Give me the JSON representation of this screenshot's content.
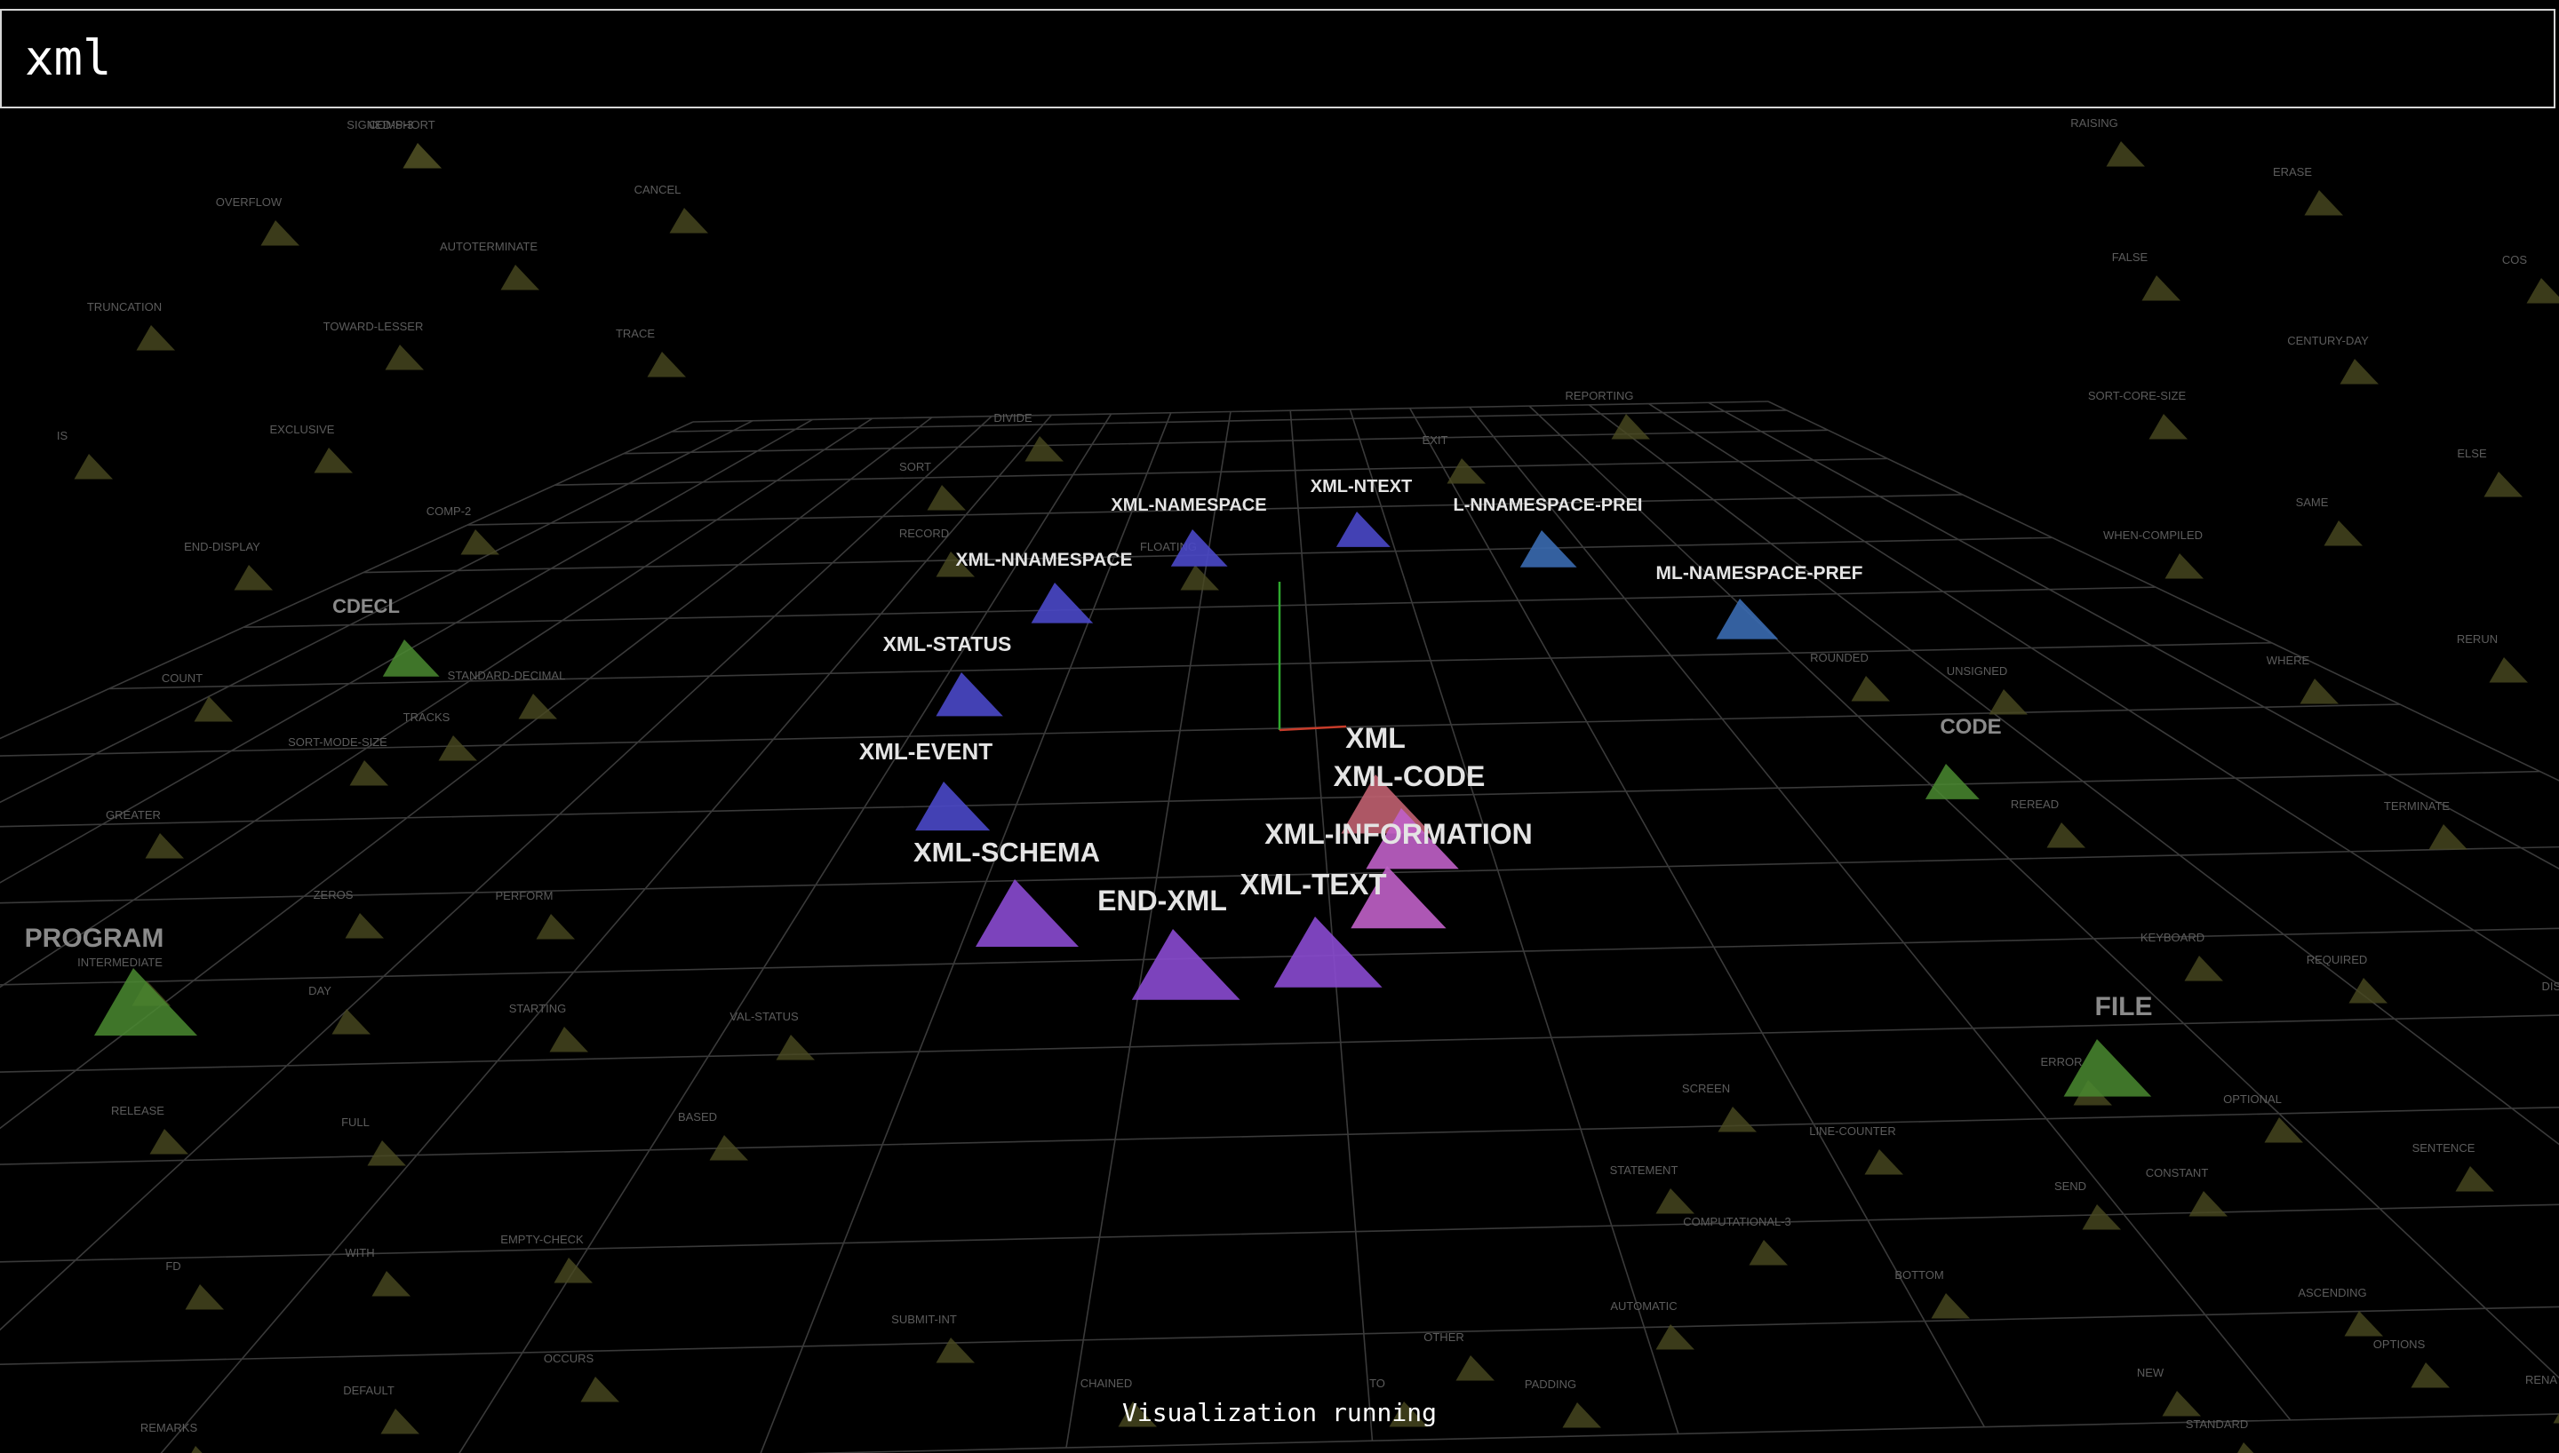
{
  "search": {
    "value": "xml"
  },
  "status": {
    "text": "Visualization running"
  },
  "colors": {
    "background": "#000000",
    "grid": "#3a3a3a",
    "match_blue": "#4a48c8",
    "match_purple": "#8a4ad0",
    "match_pink": "#c060c8",
    "match_red": "#c06070",
    "near_green": "#4a8a30",
    "dim_olive": "#4a4a20",
    "axis_green": "#2ea82e",
    "axis_red": "#c83c2a"
  },
  "highlighted_nodes": [
    {
      "label": "XML-NAMESPACE",
      "color": "blue"
    },
    {
      "label": "XML-NTEXT",
      "color": "blue"
    },
    {
      "label": "L-NNAMESPACE-PREI",
      "color": "steel"
    },
    {
      "label": "XML-NNAMESPACE",
      "color": "blue"
    },
    {
      "label": "ML-NAMESPACE-PREF",
      "color": "steel"
    },
    {
      "label": "XML-STATUS",
      "color": "blue"
    },
    {
      "label": "XML-EVENT",
      "color": "blue"
    },
    {
      "label": "XML",
      "color": "red"
    },
    {
      "label": "XML-CODE",
      "color": "pink"
    },
    {
      "label": "XML-INFORMATION",
      "color": "pink"
    },
    {
      "label": "XML-SCHEMA",
      "color": "purple"
    },
    {
      "label": "END-XML",
      "color": "purple"
    },
    {
      "label": "XML-TEXT",
      "color": "purple"
    }
  ],
  "near_nodes": [
    {
      "label": "CDECL"
    },
    {
      "label": "CODE"
    },
    {
      "label": "PROGRAM"
    },
    {
      "label": "FILE"
    }
  ],
  "background_nodes": [
    "COMP-3",
    "OVERFLOW",
    "TRUNCATION",
    "TOWARD-LESSER",
    "AUTOTERMINATE",
    "CANCEL",
    "EXCLUSIVE",
    "IS",
    "END-DISPLAY",
    "COMP-2",
    "COUNT",
    "SORT-MODE-SIZE",
    "GREATER",
    "ZEROS",
    "INTERMEDIATE",
    "DAY",
    "RELEASE",
    "FULL",
    "WITH",
    "FD",
    "REMARKS",
    "DEFAULT",
    "OCCURS",
    "EMPTY-CHECK",
    "RAISING",
    "ERASE",
    "FALSE",
    "COS",
    "CENTURY-DAY",
    "SORT-CORE-SIZE",
    "ELSE",
    "SAME",
    "WHEN-COMPILED",
    "WHERE",
    "RERUN",
    "UNSIGNED",
    "REREAD",
    "TERMINATE",
    "KEYBOARD",
    "REQUIRED",
    "DISAB",
    "OPTIONAL",
    "SENTENCE",
    "CONSTANT",
    "ASCENDING",
    "OPTIONS",
    "STANDARD",
    "RENA",
    "STANDARD-DECIMAL",
    "TRACKS",
    "PERFORM",
    "STARTING",
    "BASED",
    "VAL-STATUS",
    "ROUNDED",
    "ERROR",
    "SCREEN",
    "LINE-COUNTER",
    "TRACE",
    "BOTTOM",
    "NEW",
    "TO",
    "PADDING",
    "AUTOMATIC",
    "COMPUTATIONAL-3",
    "STATEMENT",
    "OTHER",
    "CHAINED",
    "SUBMIT-INT",
    "REPORTING",
    "SEND",
    "RECORD",
    "EXIT",
    "FLOATING",
    "SORT",
    "DIVIDE",
    "SIGNED-SHORT"
  ]
}
